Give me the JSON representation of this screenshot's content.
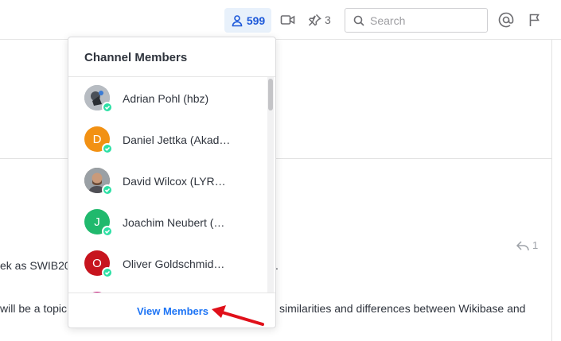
{
  "header": {
    "members_count": "599",
    "pinned_count": "3",
    "search_placeholder": "Search"
  },
  "popover": {
    "title": "Channel Members",
    "members": [
      {
        "name": "Adrian Pohl (hbz)",
        "initial": "",
        "avatar_color": "#8a8f96",
        "status": "online"
      },
      {
        "name": "Daniel Jettka (Akad…",
        "initial": "D",
        "avatar_color": "#f29113",
        "status": "online"
      },
      {
        "name": "David Wilcox (LYR…",
        "initial": "",
        "avatar_color": "#7c6a5a",
        "status": "online"
      },
      {
        "name": "Joachim Neubert (…",
        "initial": "J",
        "avatar_color": "#20b96d",
        "status": "online"
      },
      {
        "name": "Oliver Goldschmid…",
        "initial": "O",
        "avatar_color": "#c7141e",
        "status": "online"
      },
      {
        "name": "",
        "initial": "",
        "avatar_color": "#c9137a",
        "status": "online"
      }
    ],
    "view_members_label": "View Members"
  },
  "background": {
    "reply_count": "1",
    "line1": "ek as SWIB20,",
    "line1_tail": ".",
    "line2": "will be a topic.",
    "line2_tail": "similarities and differences between Wikibase and"
  },
  "colors": {
    "accent": "#1d74f5",
    "online": "#2de0a5",
    "arrow": "#e0101a"
  }
}
